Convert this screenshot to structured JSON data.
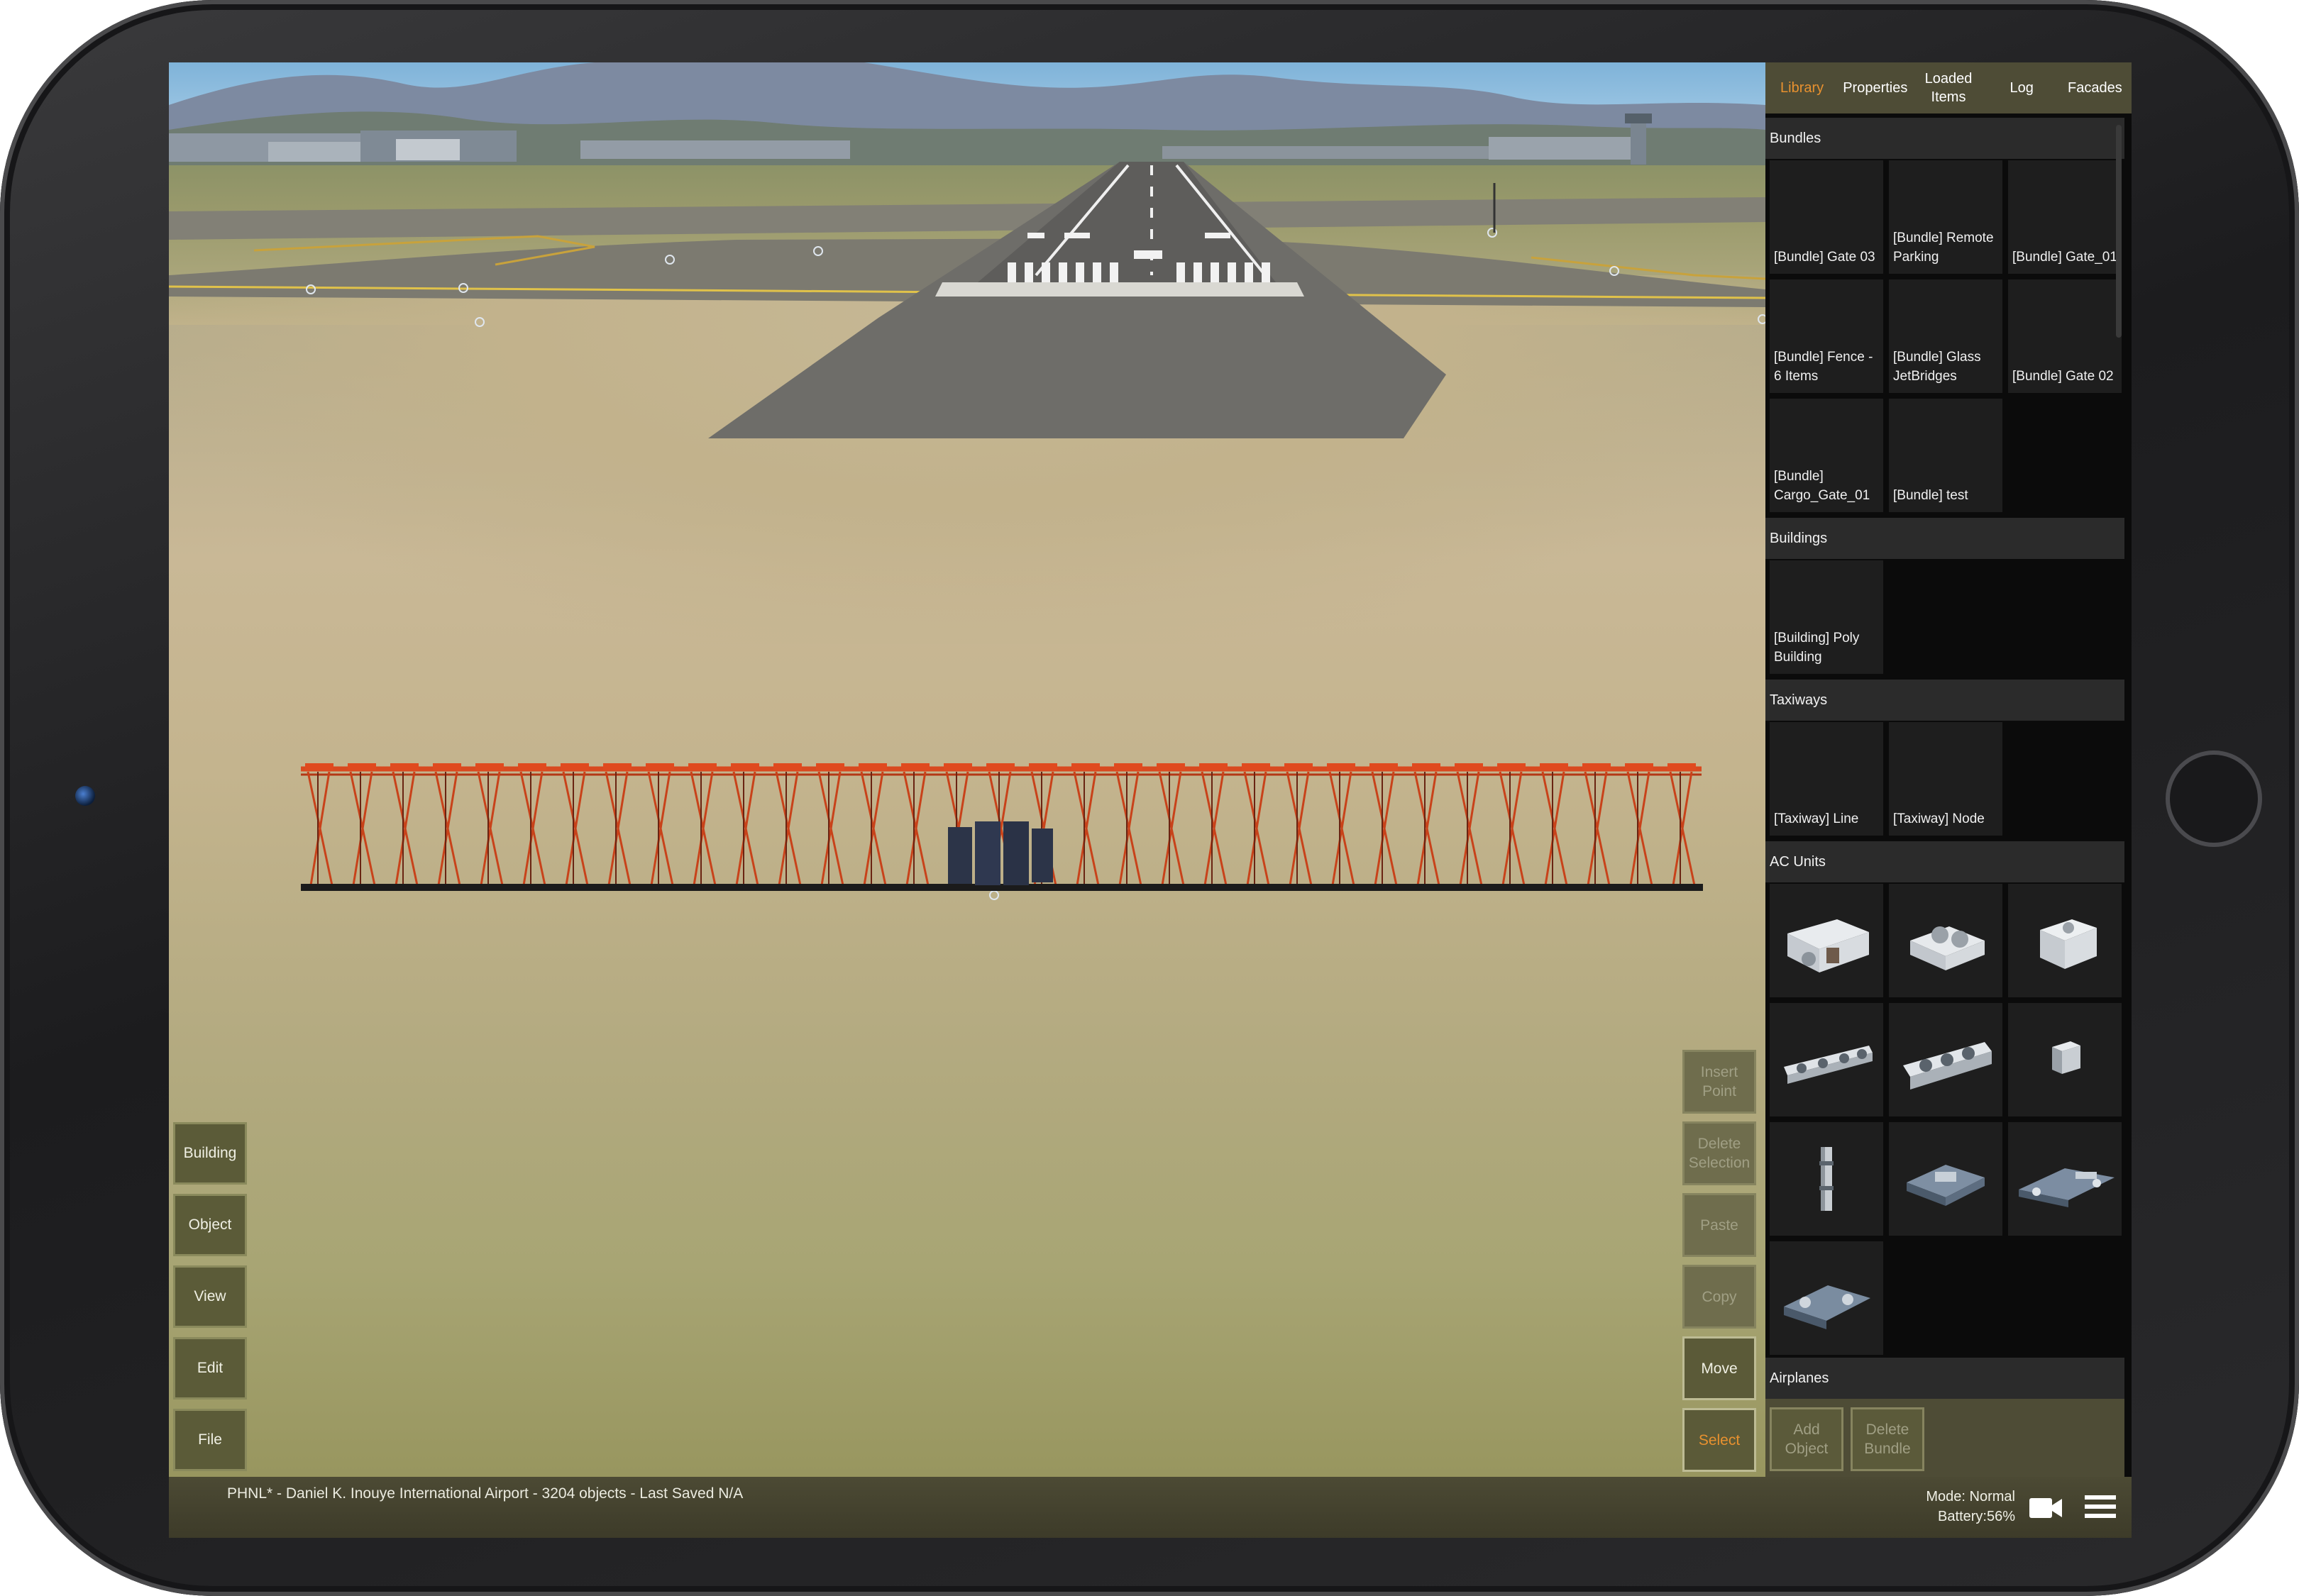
{
  "status": {
    "file_info": "PHNL* - Daniel K. Inouye International Airport - 3204 objects - Last Saved N/A",
    "mode": "Mode: Normal",
    "battery": "Battery:56%"
  },
  "left_toolbar": [
    "Building",
    "Object",
    "View",
    "Edit",
    "File"
  ],
  "right_toolbar": {
    "insert_point": "Insert Point",
    "delete_selection": "Delete Selection",
    "paste": "Paste",
    "copy": "Copy",
    "move": "Move",
    "select": "Select"
  },
  "tabs": [
    "Library",
    "Properties",
    "Loaded Items",
    "Log",
    "Facades"
  ],
  "active_tab": "Library",
  "sections": {
    "bundles": "Bundles",
    "buildings": "Buildings",
    "taxiways": "Taxiways",
    "ac_units": "AC Units",
    "airplanes": "Airplanes"
  },
  "bundle_items": [
    "[Bundle] Gate 03",
    "[Bundle] Remote Parking",
    "[Bundle] Gate_01",
    "[Bundle] Fence - 6 Items",
    "[Bundle] Glass JetBridges",
    "[Bundle] Gate 02",
    "[Bundle] Cargo_Gate_01",
    "[Bundle] test"
  ],
  "building_items": [
    "[Building] Poly Building"
  ],
  "taxiway_items": [
    "[Taxiway] Line",
    "[Taxiway] Node"
  ],
  "ac_unit_icons": [
    "ac-unit-1-icon",
    "ac-unit-2-icon",
    "ac-unit-3-icon",
    "ac-unit-4-icon",
    "ac-unit-5-icon",
    "ac-unit-6-icon",
    "ac-unit-7-icon",
    "ac-unit-8-icon",
    "ac-unit-9-icon",
    "ac-unit-10-icon"
  ],
  "bottom_tools": {
    "add_object": "Add Object",
    "delete_bundle": "Delete Bundle"
  },
  "colors": {
    "accent": "#e8912f",
    "toolbar": "#4e4c36",
    "button": "#5b5a38",
    "approach_lights": "#d2451c"
  }
}
